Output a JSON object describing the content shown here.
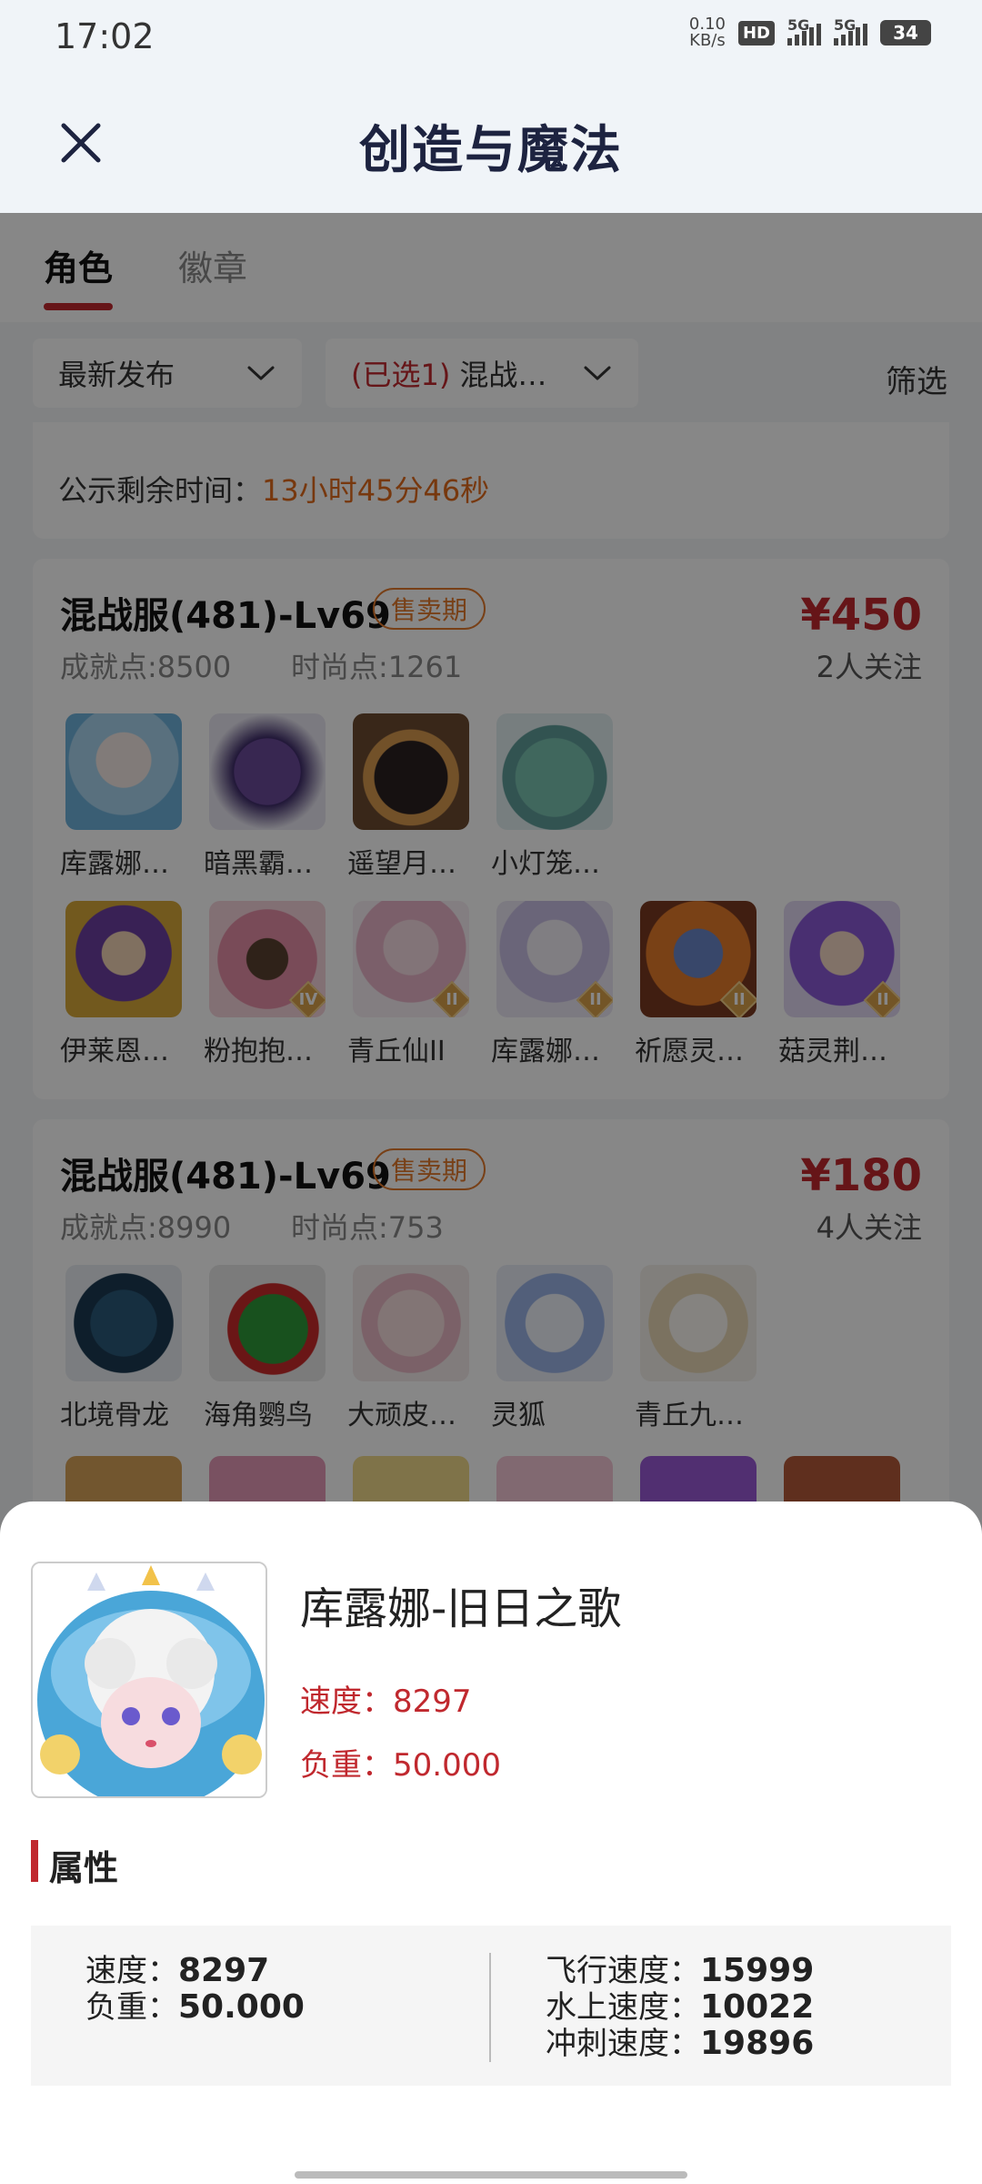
{
  "status_bar": {
    "time": "17:02",
    "net_speed_value": "0.10",
    "net_speed_unit": "KB/s",
    "hd": "HD",
    "signal1": "5G",
    "signal2": "5G",
    "battery": "34"
  },
  "header": {
    "title": "创造与魔法"
  },
  "tabs": [
    {
      "label": "角色"
    },
    {
      "label": "徽章"
    }
  ],
  "filters": {
    "sort": "最新发布",
    "server_selected": "(已选1)",
    "server_value": "混战…",
    "filter": "筛选"
  },
  "notice": {
    "label": "公示剩余时间：",
    "countdown": "13小时45分46秒"
  },
  "listings": [
    {
      "server": "混战服(481)-Lv69",
      "phase": "售卖期",
      "price": "¥450",
      "follows": "2人关注",
      "achievement": "成就点:8500",
      "fashion": "时尚点:1261",
      "pets": [
        {
          "name": "库露娜…",
          "tier": ""
        },
        {
          "name": "暗黑霸…",
          "tier": ""
        },
        {
          "name": "遥望月…",
          "tier": ""
        },
        {
          "name": "小灯笼…",
          "tier": ""
        },
        {
          "name": "伊莱恩…",
          "tier": ""
        },
        {
          "name": "粉抱抱…",
          "tier": "IV"
        },
        {
          "name": "青丘仙II",
          "tier": "II"
        },
        {
          "name": "库露娜…",
          "tier": "II"
        },
        {
          "name": "祈愿灵…",
          "tier": "II"
        },
        {
          "name": "菇灵荆…",
          "tier": "II"
        }
      ]
    },
    {
      "server": "混战服(481)-Lv69",
      "phase": "售卖期",
      "price": "¥180",
      "follows": "4人关注",
      "achievement": "成就点:8990",
      "fashion": "时尚点:753",
      "pets": [
        {
          "name": "北境骨龙"
        },
        {
          "name": "海角鹦鸟"
        },
        {
          "name": "大顽皮…"
        },
        {
          "name": "灵狐"
        },
        {
          "name": "青丘九…"
        }
      ]
    }
  ],
  "detail": {
    "name": "库露娜-旧日之歌",
    "speed_line": "速度：8297",
    "load_line": "负重：50.000",
    "section_title": "属性",
    "attrs_left": [
      {
        "label": "速度：",
        "value": "8297"
      },
      {
        "label": "负重：",
        "value": "50.000"
      }
    ],
    "attrs_right": [
      {
        "label": "飞行速度：",
        "value": "15999"
      },
      {
        "label": "水上速度：",
        "value": "10022"
      },
      {
        "label": "冲刺速度：",
        "value": "19896"
      }
    ]
  },
  "colors": {
    "accent": "#c0282e",
    "countdown": "#e06a1b",
    "phase_badge": "#e27a2c",
    "title": "#1d2340"
  }
}
